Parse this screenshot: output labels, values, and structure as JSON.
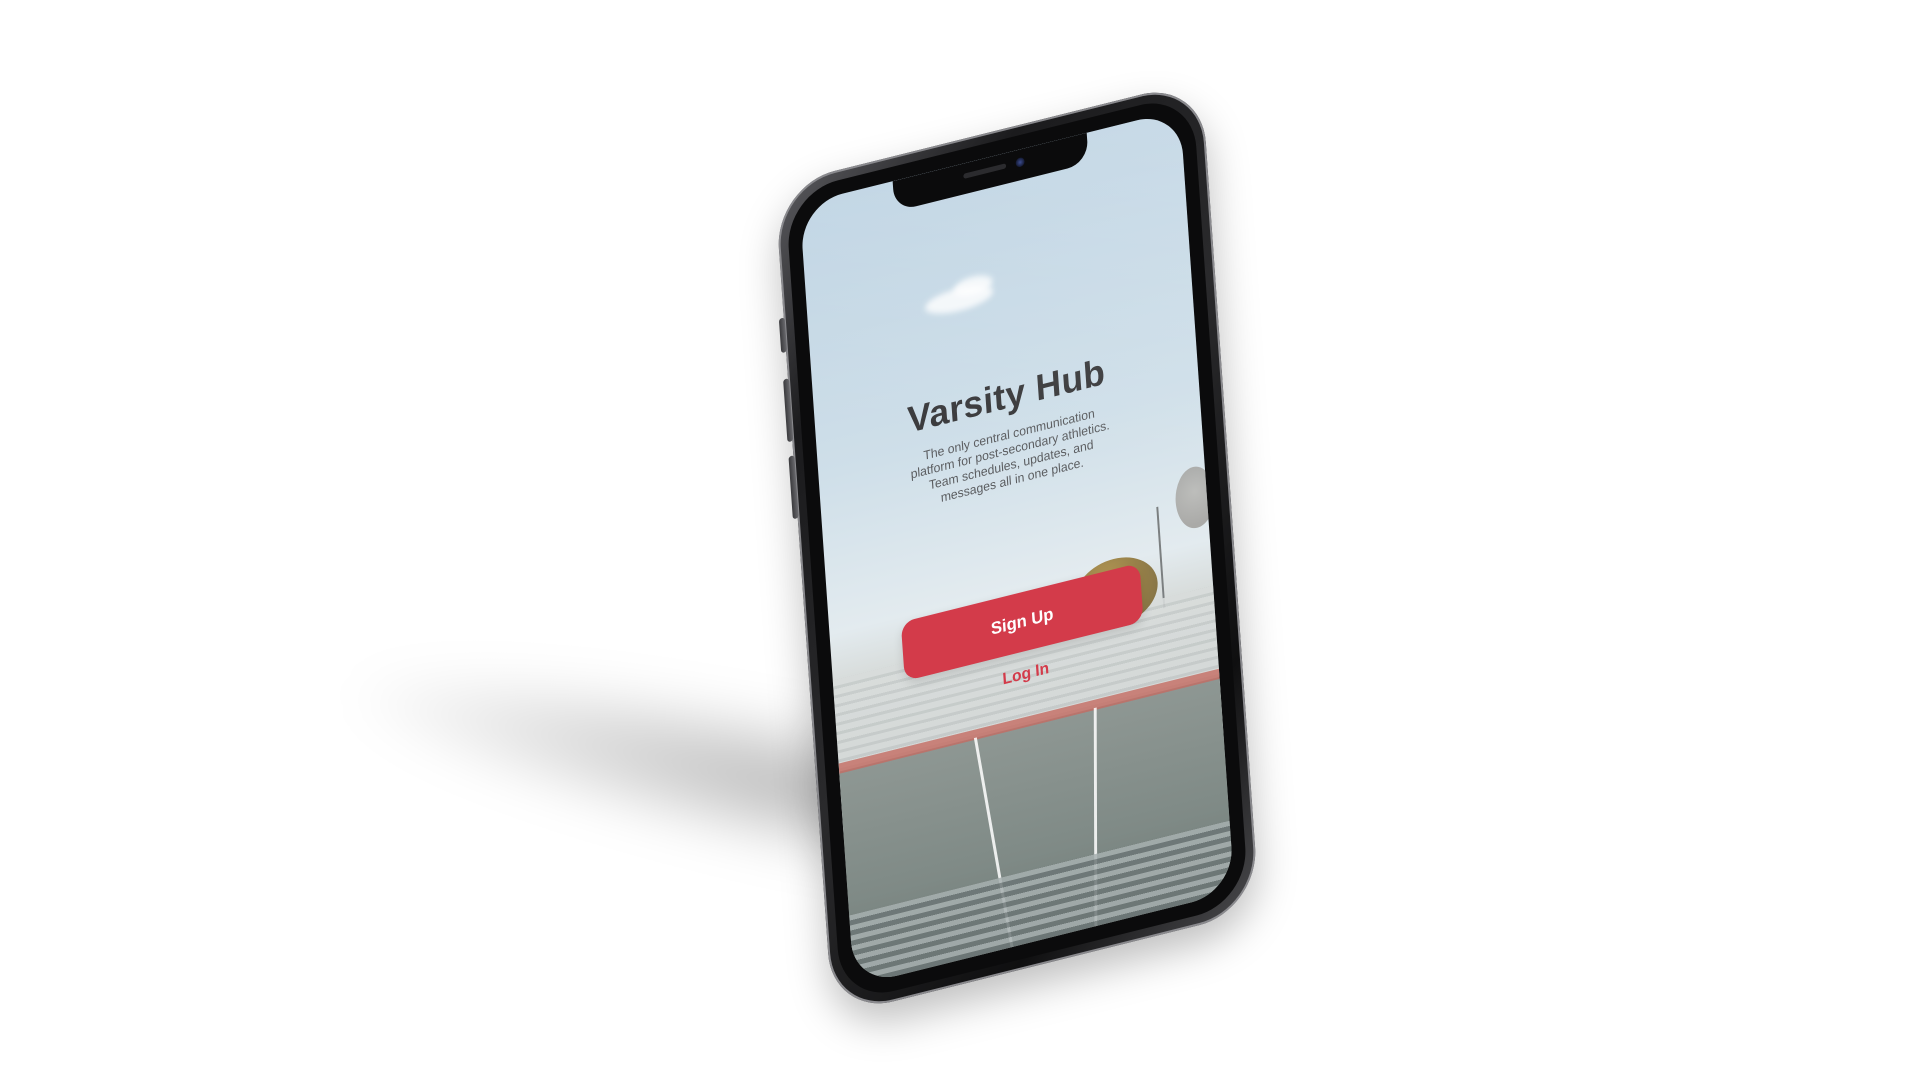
{
  "app": {
    "title": "Varsity Hub",
    "tagline": "The only central communication platform for post-secondary athletics. Team schedules, updates, and messages all in one place."
  },
  "actions": {
    "signup_label": "Sign Up",
    "login_label": "Log In"
  },
  "colors": {
    "accent": "#d33b4a",
    "title_text": "#3a3a3c",
    "background": "#ffffff"
  },
  "icons": {
    "camera": "front-camera-icon"
  }
}
